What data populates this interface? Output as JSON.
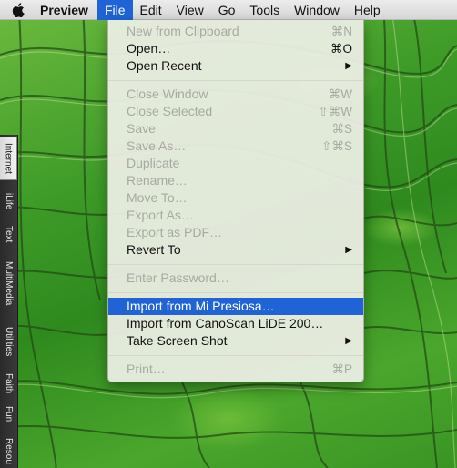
{
  "menubar": {
    "apple": "apple-icon",
    "items": [
      "Preview",
      "File",
      "Edit",
      "View",
      "Go",
      "Tools",
      "Window",
      "Help"
    ],
    "active": "File"
  },
  "side_tabs": [
    "Internet",
    "iLife",
    "Text",
    "MultiMedia",
    "Utilities",
    "Faith",
    "Fun",
    "Resou"
  ],
  "file_menu": {
    "new_from_clipboard": {
      "label": "New from Clipboard",
      "shortcut": "⌘N"
    },
    "open": {
      "label": "Open…",
      "shortcut": "⌘O"
    },
    "open_recent": {
      "label": "Open Recent",
      "submenu": "▶"
    },
    "close_window": {
      "label": "Close Window",
      "shortcut": "⌘W"
    },
    "close_selected": {
      "label": "Close Selected",
      "shortcut": "⇧⌘W"
    },
    "save": {
      "label": "Save",
      "shortcut": "⌘S"
    },
    "save_as": {
      "label": "Save As…",
      "shortcut": "⇧⌘S"
    },
    "duplicate": {
      "label": "Duplicate"
    },
    "rename": {
      "label": "Rename…"
    },
    "move_to": {
      "label": "Move To…"
    },
    "export_as": {
      "label": "Export As…"
    },
    "export_as_pdf": {
      "label": "Export as PDF…"
    },
    "revert_to": {
      "label": "Revert To",
      "submenu": "▶"
    },
    "enter_password": {
      "label": "Enter Password…"
    },
    "import_mi_presiosa": {
      "label": "Import from Mi Presiosa…"
    },
    "import_canoscan": {
      "label": "Import from CanoScan LiDE 200…"
    },
    "take_screen_shot": {
      "label": "Take Screen Shot",
      "submenu": "▶"
    },
    "print": {
      "label": "Print…",
      "shortcut": "⌘P"
    }
  }
}
